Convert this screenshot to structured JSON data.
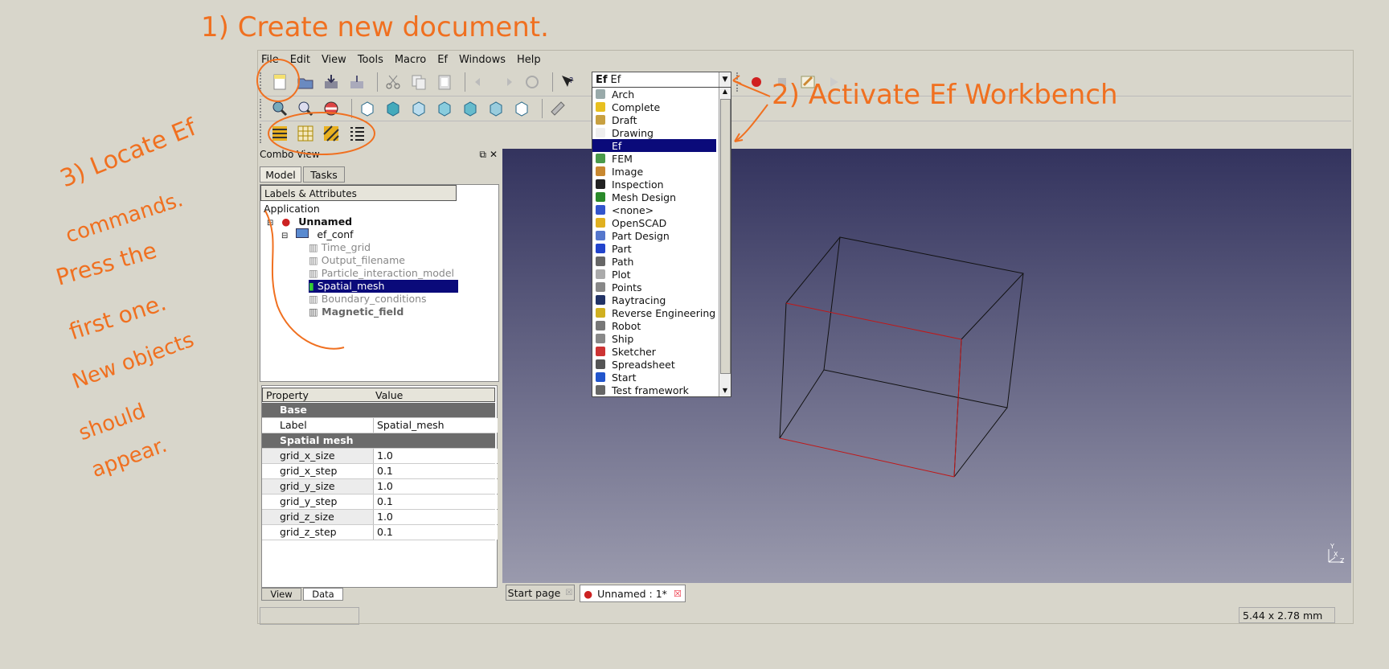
{
  "menu": [
    "File",
    "Edit",
    "View",
    "Tools",
    "Macro",
    "Ef",
    "Windows",
    "Help"
  ],
  "workbench": {
    "selected": "Ef",
    "options": [
      {
        "label": "Arch",
        "color": "#9aa"
      },
      {
        "label": "Complete",
        "color": "#e8c020"
      },
      {
        "label": "Draft",
        "color": "#c8a040"
      },
      {
        "label": "Drawing",
        "color": "#eeeeee"
      },
      {
        "label": "Ef",
        "color": "#0a0a7a"
      },
      {
        "label": "FEM",
        "color": "#4a9a4a"
      },
      {
        "label": "Image",
        "color": "#c88830"
      },
      {
        "label": "Inspection",
        "color": "#222222"
      },
      {
        "label": "Mesh Design",
        "color": "#2a8a2a"
      },
      {
        "label": "<none>",
        "color": "#3355cc"
      },
      {
        "label": "OpenSCAD",
        "color": "#e0b020"
      },
      {
        "label": "Part Design",
        "color": "#5577cc"
      },
      {
        "label": "Part",
        "color": "#2244cc"
      },
      {
        "label": "Path",
        "color": "#666666"
      },
      {
        "label": "Plot",
        "color": "#aaaaaa"
      },
      {
        "label": "Points",
        "color": "#888888"
      },
      {
        "label": "Raytracing",
        "color": "#223366"
      },
      {
        "label": "Reverse Engineering",
        "color": "#d0b020"
      },
      {
        "label": "Robot",
        "color": "#777777"
      },
      {
        "label": "Ship",
        "color": "#888888"
      },
      {
        "label": "Sketcher",
        "color": "#cc3333"
      },
      {
        "label": "Spreadsheet",
        "color": "#555555"
      },
      {
        "label": "Start",
        "color": "#2255cc"
      },
      {
        "label": "Test framework",
        "color": "#666666"
      }
    ]
  },
  "combo_view": {
    "title": "Combo View",
    "tab_model": "Model",
    "tab_tasks": "Tasks",
    "header": "Labels & Attributes",
    "root": "Application",
    "doc": "Unnamed",
    "group": "ef_conf",
    "children": [
      "Time_grid",
      "Output_filename",
      "Particle_interaction_model",
      "Spatial_mesh",
      "Boundary_conditions",
      "Magnetic_field"
    ]
  },
  "properties": {
    "col_property": "Property",
    "col_value": "Value",
    "group_base": "Base",
    "label_key": "Label",
    "label_value": "Spatial_mesh",
    "group_mesh": "Spatial mesh",
    "rows": [
      {
        "k": "grid_x_size",
        "v": "1.0"
      },
      {
        "k": "grid_x_step",
        "v": "0.1"
      },
      {
        "k": "grid_y_size",
        "v": "1.0"
      },
      {
        "k": "grid_y_step",
        "v": "0.1"
      },
      {
        "k": "grid_z_size",
        "v": "1.0"
      },
      {
        "k": "grid_z_step",
        "v": "0.1"
      }
    ],
    "tab_view": "View",
    "tab_data": "Data"
  },
  "doc_tabs": {
    "start": "Start page",
    "unnamed": "Unnamed : 1*"
  },
  "status": {
    "dimensions": "5.44 x 2.78 mm"
  },
  "annotations": {
    "a1": "1) Create new document.",
    "a2": "2) Activate Ef Workbench",
    "a3_l1": "3) Locate Ef",
    "a3_l2": "commands.",
    "a3_l3": "Press the",
    "a3_l4": "first one.",
    "a3_l5": "New objects",
    "a3_l6": "should",
    "a3_l7": "appear."
  },
  "axes": {
    "x": "X",
    "y": "Y",
    "z": "Z"
  }
}
